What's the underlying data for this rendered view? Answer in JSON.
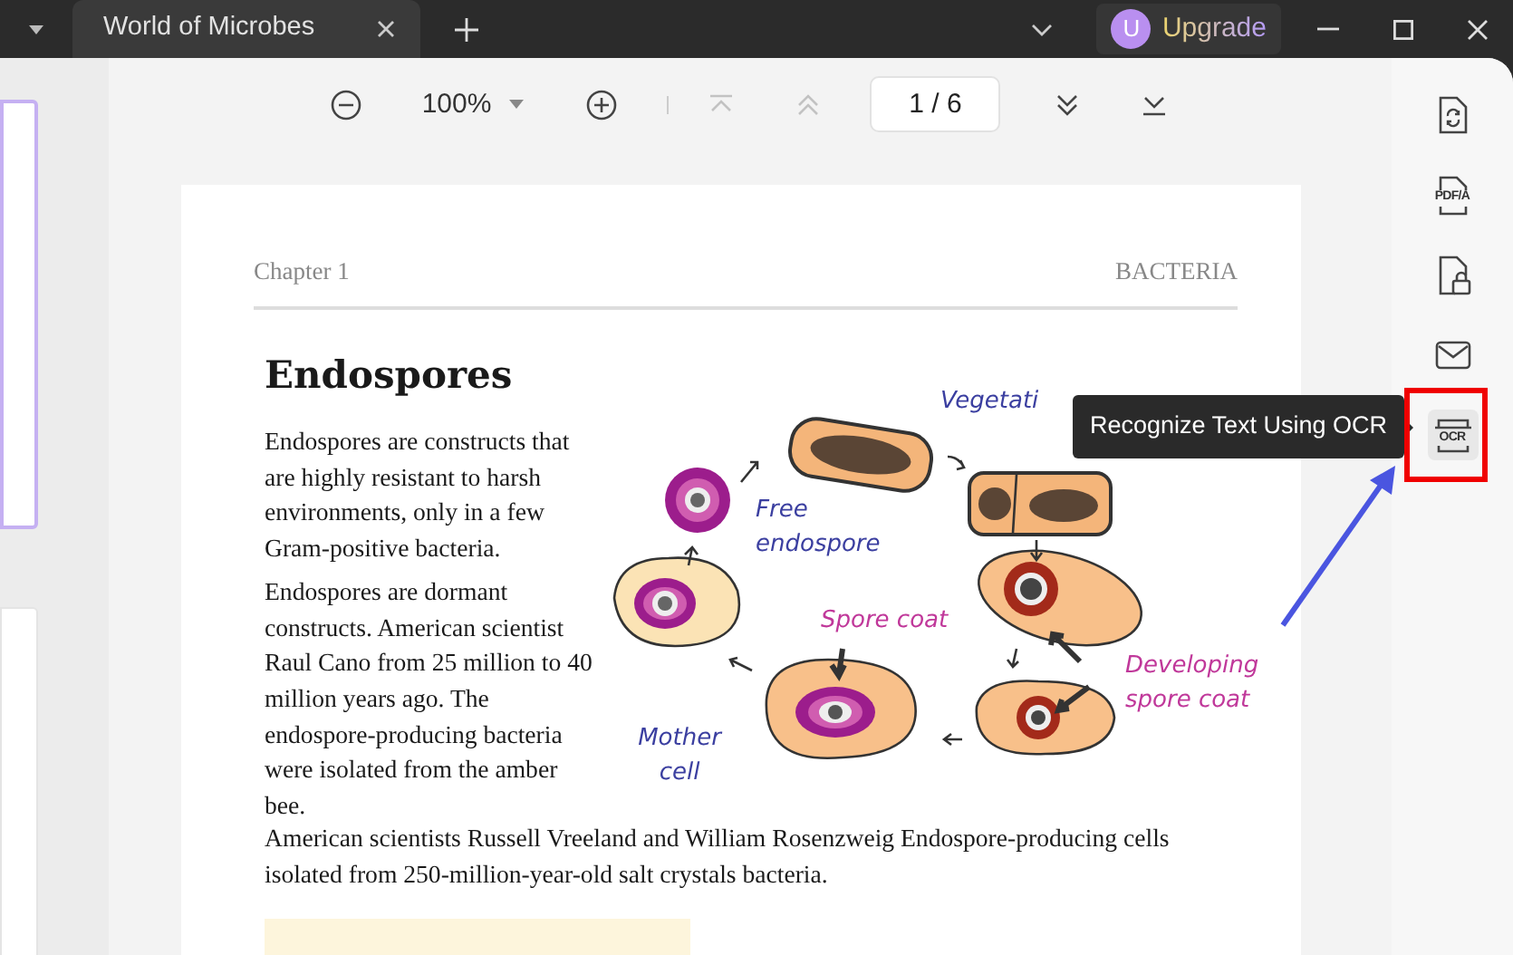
{
  "window": {
    "tab_title": "World of Microbes",
    "upgrade": {
      "avatar": "U",
      "label": "Upgrade"
    }
  },
  "thumbnails": [
    {
      "selected": true
    },
    {
      "selected": false
    }
  ],
  "toolbar": {
    "zoom": "100%",
    "page": "1 / 6",
    "nav_buttons": [
      {
        "kind": "first",
        "disabled": true
      },
      {
        "kind": "prev",
        "disabled": true
      },
      {
        "kind": "next",
        "disabled": false
      },
      {
        "kind": "last",
        "disabled": false
      }
    ]
  },
  "document": {
    "header_left": "Chapter 1",
    "header_right": "BACTERIA",
    "title": "Endospores",
    "paragraphs": [
      "Endospores are constructs that are highly resistant to harsh environments, only in a few Gram-positive bacteria.",
      "Endospores are dormant constructs. American scientist Raul Cano from 25 million to 40 million years ago. The endospore-producing bacteria were isolated from the amber bee."
    ],
    "diagram_labels": [
      {
        "text": "Vegetati",
        "color": "#3b3fa0"
      },
      {
        "text": "Free endospore",
        "color": "#3b3fa0"
      },
      {
        "text": "Spore coat",
        "color": "#c0389a"
      },
      {
        "text": "Developing spore coat",
        "color": "#c0389a"
      },
      {
        "text": "Mother cell",
        "color": "#3b3fa0"
      }
    ],
    "footer_paragraph": "American scientists Russell Vreeland and William Rosenzweig Endospore-producing cells isolated from 250-million-year-old salt crystals bacteria."
  },
  "tools": [
    {
      "kind": "convert"
    },
    {
      "kind": "pdfa",
      "text": "PDF/A"
    },
    {
      "kind": "protect"
    },
    {
      "kind": "mail"
    },
    {
      "kind": "ocr",
      "text": "OCR"
    }
  ],
  "tooltip": "Recognize Text Using OCR"
}
